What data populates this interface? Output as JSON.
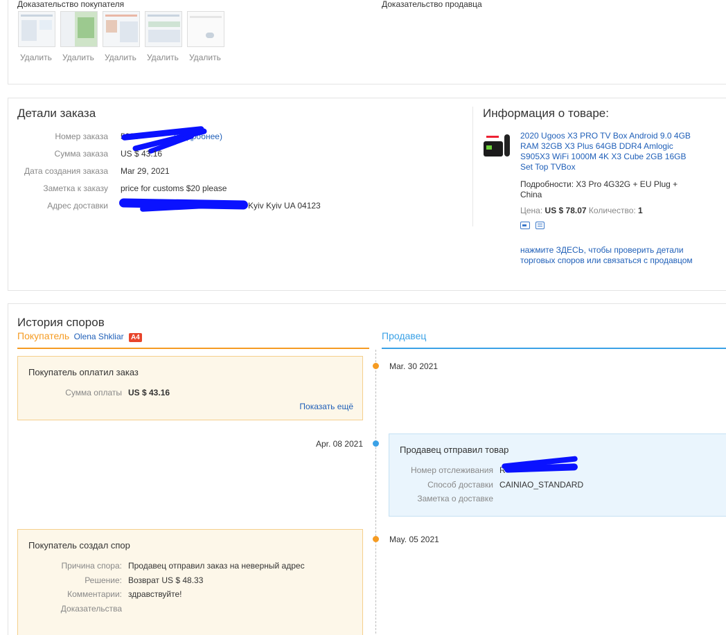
{
  "evidence": {
    "buyer_title": "Доказательство покупателя",
    "seller_title": "Доказательство продавца",
    "delete_label": "Удалить"
  },
  "order": {
    "title": "Детали заказа",
    "number_label": "Номер заказа",
    "more_link": "Подробнее",
    "sum_label": "Сумма заказа",
    "sum_value": "US $ 43.16",
    "date_label": "Дата создания заказа",
    "date_value": "Mar 29, 2021",
    "note_label": "Заметка к заказу",
    "note_value": "price for customs $20 please",
    "address_label": "Адрес доставки",
    "address_tail": "Kyiv Kyiv UA 04123"
  },
  "product": {
    "title": "Информация о товаре:",
    "name": "2020 Ugoos X3 PRO TV Box Android 9.0 4GB RAM 32GB X3 Plus 64GB DDR4 Amlogic S905X3 WiFi 1000M 4K X3 Cube 2GB 16GB Set Top TVBox",
    "details": "Подробности: X3 Pro 4G32G + EU Plug + China",
    "price_label": "Цена:",
    "price_value": "US $ 78.07",
    "qty_label": "Количество:",
    "qty_value": "1",
    "help_link": "нажмите ЗДЕСЬ, чтобы проверить детали торговых споров или связаться с продавцом",
    "icons": [
      "delivery-icon",
      "message-icon"
    ]
  },
  "history": {
    "title": "История споров",
    "buyer_tab": "Покупатель",
    "buyer_name": "Olena Shkliar",
    "buyer_badge": "A4",
    "seller_tab": "Продавец",
    "colors": {
      "buyer": "#f59b22",
      "seller": "#3aa1e6",
      "badge": "#e8452c"
    },
    "events": {
      "e1": {
        "date": "Mar. 30 2021",
        "title": "Покупатель оплатил заказ",
        "sum_label": "Сумма оплаты",
        "sum_value": "US $ 43.16",
        "show_more": "Показать ещё"
      },
      "e2": {
        "date": "Apr. 08 2021",
        "title": "Продавец отправил товар",
        "tracking_label": "Номер отслеживания",
        "tracking_value": "R",
        "method_label": "Способ доставки",
        "method_value": "CAINIAO_STANDARD",
        "note_label": "Заметка о доставке"
      },
      "e3": {
        "date": "May. 05 2021",
        "title": "Покупатель создал спор",
        "reason_label": "Причина спора:",
        "reason_value": "Продавец отправил заказ на неверный адрес",
        "solution_label": "Решение:",
        "solution_value": "Возврат US $ 48.33",
        "comments_label": "Комментарии:",
        "comments_value": "здравствуйте!",
        "evidence_label": "Доказательства"
      }
    }
  }
}
